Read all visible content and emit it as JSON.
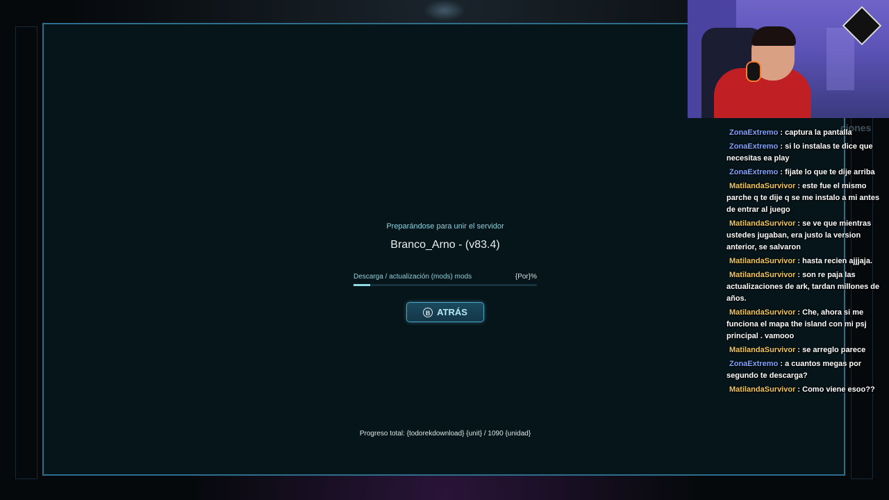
{
  "loading": {
    "status": "Preparándose para unir el servidor",
    "server": "Branco_Arno - (v83.4)",
    "progress_label": "Descarga / actualización (mods) mods",
    "progress_percent_text": "{Por}%",
    "progress_fraction": 0.09,
    "back_button": {
      "icon": "B",
      "label": "ATRÁS"
    },
    "total_progress": "Progreso total: {todorekdownload} {unit} / 1090 {unidad}"
  },
  "chat_header": "ciones",
  "chat": [
    {
      "user": "ZonaExtremo",
      "color": "#7fa3ff",
      "text": "captura la pantalla"
    },
    {
      "user": "ZonaExtremo",
      "color": "#7fa3ff",
      "text": "si lo instalas te dice que necesitas ea play"
    },
    {
      "user": "ZonaExtremo",
      "color": "#7fa3ff",
      "text": "fijate lo que te dije arriba"
    },
    {
      "user": "MatilandaSurvivor",
      "color": "#f1c75c",
      "text": "este fue el mismo parche q te dije q se me instalo a mi antes de entrar al juego"
    },
    {
      "user": "MatilandaSurvivor",
      "color": "#f1c75c",
      "text": "se ve que mientras ustedes jugaban, era justo la version anterior, se salvaron"
    },
    {
      "user": "MatilandaSurvivor",
      "color": "#f1c75c",
      "text": "hasta recien ajjjaja."
    },
    {
      "user": "MatilandaSurvivor",
      "color": "#f1c75c",
      "text": "son re paja las actualizaciones de ark, tardan millones de años."
    },
    {
      "user": "MatilandaSurvivor",
      "color": "#f1c75c",
      "text": "Che, ahora si me funciona el mapa the island con mi psj principal . vamooo"
    },
    {
      "user": "MatilandaSurvivor",
      "color": "#f1c75c",
      "text": "se arreglo parece"
    },
    {
      "user": "ZonaExtremo",
      "color": "#7fa3ff",
      "text": "a cuantos megas por segundo te descarga?"
    },
    {
      "user": "MatilandaSurvivor",
      "color": "#f1c75c",
      "text": "Como viene esoo??"
    }
  ]
}
